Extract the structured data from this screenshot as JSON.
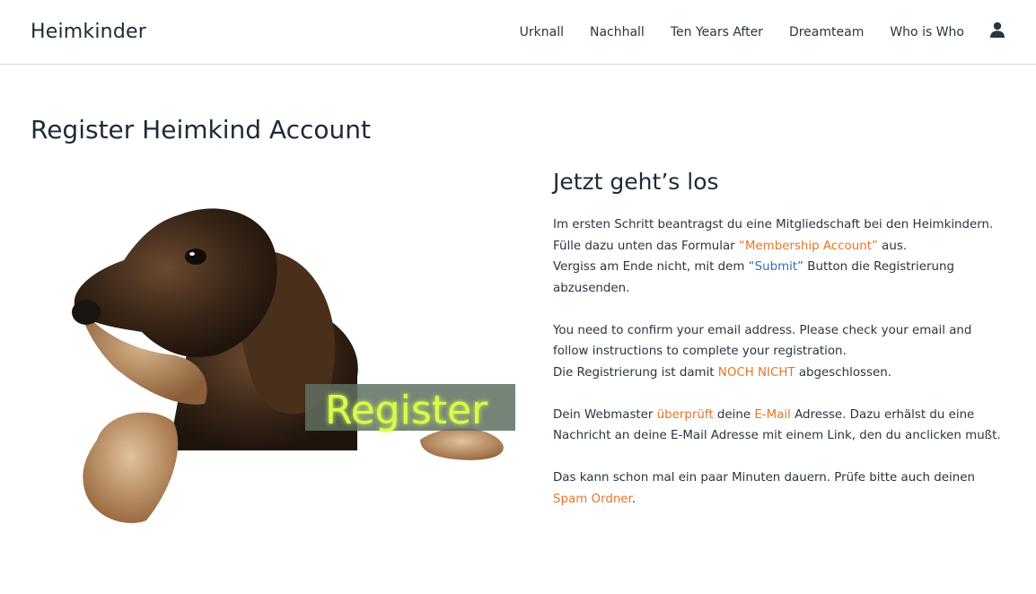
{
  "header": {
    "brand": "Heimkinder",
    "nav": [
      {
        "label": "Urknall"
      },
      {
        "label": "Nachhall"
      },
      {
        "label": "Ten Years After"
      },
      {
        "label": "Dreamteam"
      },
      {
        "label": "Who is Who"
      }
    ],
    "user_icon": "user-icon"
  },
  "main": {
    "title": "Register Heimkind Account",
    "image": {
      "overlay_text": "Register"
    },
    "content": {
      "heading": "Jetzt geht’s los",
      "p1": {
        "t1": "Im ersten Schritt beantragst du eine Mitgliedschaft bei den Heimkindern. Fülle dazu unten das Formular ",
        "link1": "“Membership Account”",
        "t2": " aus.",
        "t3": "Vergiss am Ende nicht, mit dem ",
        "link2": "“Submit”",
        "t4": " Button die Registrierung abzusenden."
      },
      "p2": {
        "t1": "You need to confirm your email address. Please check your email and follow instructions to complete your registration.",
        "t2": "Die Registrierung ist damit ",
        "highlight": "NOCH NICHT",
        "t3": " abgeschlossen."
      },
      "p3": {
        "t1": "Dein Webmaster ",
        "h1": "überprüft",
        "t2": " deine ",
        "h2": "E-Mail",
        "t3": " Adresse. Dazu erhälst du eine Nachricht an deine E-Mail Adresse mit einem Link, den du anclicken mußt."
      },
      "p4": {
        "t1": "Das kann schon mal ein paar Minuten dauern. Prüfe bitte auch deinen ",
        "h1": "Spam Ordner",
        "t2": "."
      }
    }
  },
  "colors": {
    "accent_orange": "#e8742a",
    "link_blue": "#2f6fb5",
    "text_dark": "#1f2a37"
  }
}
